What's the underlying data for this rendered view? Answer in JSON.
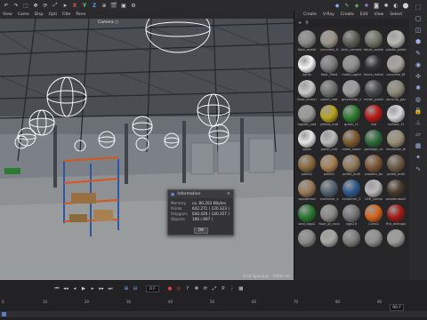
{
  "toolbar": {
    "icons": [
      "undo-icon",
      "redo-icon",
      "select-icon",
      "move-icon",
      "rotate-icon",
      "scale-icon",
      "pointer-icon",
      "axis-x",
      "axis-y",
      "axis-z",
      "coord-icon",
      "render-icon",
      "render-view-icon",
      "render-settings-icon",
      "cube-icon",
      "pen-icon",
      "subdivide-icon",
      "deformer-icon",
      "camera-icon",
      "light-icon",
      "sky-icon",
      "tag-icon"
    ],
    "axis": {
      "x": "X",
      "y": "Y",
      "z": "Z"
    }
  },
  "viewport_menu": [
    "View",
    "Came",
    "Disp",
    "Opti",
    "Filte",
    "Pane"
  ],
  "viewport": {
    "camera": "Camera ○",
    "grid_spacing": "Grid Spacing : 1000 cm"
  },
  "info_dialog": {
    "title": "Information",
    "rows": [
      {
        "k": "Memory",
        "v": "ca. 80.203 KBytes"
      },
      {
        "k": "Points",
        "v": "642.271 ( 120.323 )"
      },
      {
        "k": "Polygons",
        "v": "640.426 ( 140.357 )"
      },
      {
        "k": "Objects",
        "v": "196 ( 897 )"
      }
    ],
    "ok": "OK"
  },
  "material_panel": {
    "menu": [
      "Create",
      "V-Ray",
      "Create",
      "Edit",
      "View",
      "Select"
    ],
    "materials": [
      {
        "name": "floor_metal",
        "color": "#8a8a88"
      },
      {
        "name": "concrete_fl",
        "color": "#9a9588"
      },
      {
        "name": "dark_cement",
        "color": "#5c5f55"
      },
      {
        "name": "fabric_metal",
        "color": "#6e7566"
      },
      {
        "name": "plastic_patte",
        "color": "#b9b9b3"
      },
      {
        "name": "lights",
        "color": "#f4f4f4"
      },
      {
        "name": "floor_Plast",
        "color": "#7d7d7d"
      },
      {
        "name": "metal_agrid",
        "color": "#8e8e8e"
      },
      {
        "name": "black_metal",
        "color": "#333335"
      },
      {
        "name": "concrete_tif",
        "color": "#a8a59e"
      },
      {
        "name": "floor_emlsci",
        "color": "#c9c9c9"
      },
      {
        "name": "panel_met",
        "color": "#6f7470"
      },
      {
        "name": "greymetal_v",
        "color": "#9c9c9c"
      },
      {
        "name": "metal_partit",
        "color": "#494b4c"
      },
      {
        "name": "security_gar",
        "color": "#8e8a7b"
      },
      {
        "name": "logistic_swt",
        "color": "#9a9a96"
      },
      {
        "name": "yellow_mat",
        "color": "#b9a41e"
      },
      {
        "name": "green_r1",
        "color": "#2d7d2f"
      },
      {
        "name": "red",
        "color": "#b81b15"
      },
      {
        "name": "metalic_f1",
        "color": "#d8d8d8"
      },
      {
        "name": "glass",
        "color": "#e6e6e6"
      },
      {
        "name": "panel_outl",
        "color": "#bcbcbc"
      },
      {
        "name": "cable_wood",
        "color": "#7e5b2e"
      },
      {
        "name": "garbage_co",
        "color": "#2e6a3a"
      },
      {
        "name": "insulation_bl",
        "color": "#9b8f76"
      },
      {
        "name": "pallet2",
        "color": "#8b6a3d"
      },
      {
        "name": "pallet1",
        "color": "#a98050"
      },
      {
        "name": "pallet_outli",
        "color": "#927a5a"
      },
      {
        "name": "wooden_bo",
        "color": "#7f5734"
      },
      {
        "name": "pallet_outli",
        "color": "#6e5b45"
      },
      {
        "name": "woodentra",
        "color": "#9b7a55"
      },
      {
        "name": "container_s",
        "color": "#556470"
      },
      {
        "name": "container_2",
        "color": "#2e5a8e"
      },
      {
        "name": "LDR_contai",
        "color": "#b8b8b8"
      },
      {
        "name": "woodenbox2",
        "color": "#4a3b2a"
      },
      {
        "name": "wall_logo2",
        "color": "#2a7a2f"
      },
      {
        "name": "floor_gr_inno",
        "color": "#8a8a86"
      },
      {
        "name": "sign24",
        "color": "#777"
      },
      {
        "name": "Cone2",
        "color": "#d5641a"
      },
      {
        "name": "Fire_extingui",
        "color": "#a61b18"
      },
      {
        "name": "",
        "color": "#8b8b89"
      },
      {
        "name": "",
        "color": "#a7a7a3"
      },
      {
        "name": "",
        "color": "#7c7c79"
      },
      {
        "name": "",
        "color": "#8e8e8c"
      },
      {
        "name": "",
        "color": "#9c9c98"
      }
    ]
  },
  "right_palette": [
    "selection-icon",
    "model-icon",
    "uv-icon",
    "cube-tool-icon",
    "paint-icon",
    "sculpt-icon",
    "snap-icon",
    "tweak-icon",
    "texture-icon",
    "lock-icon",
    "axis-icon",
    "workplane-icon",
    "grid-icon",
    "light-bulb-icon",
    "spline-icon"
  ],
  "timeline": {
    "frame_start": "0 F",
    "frame_current": "0 F",
    "frame_end": "90 F",
    "end_field": "90 F",
    "ticks": [
      "0",
      "10",
      "20",
      "30",
      "40",
      "50",
      "60",
      "70",
      "80",
      "90"
    ]
  }
}
